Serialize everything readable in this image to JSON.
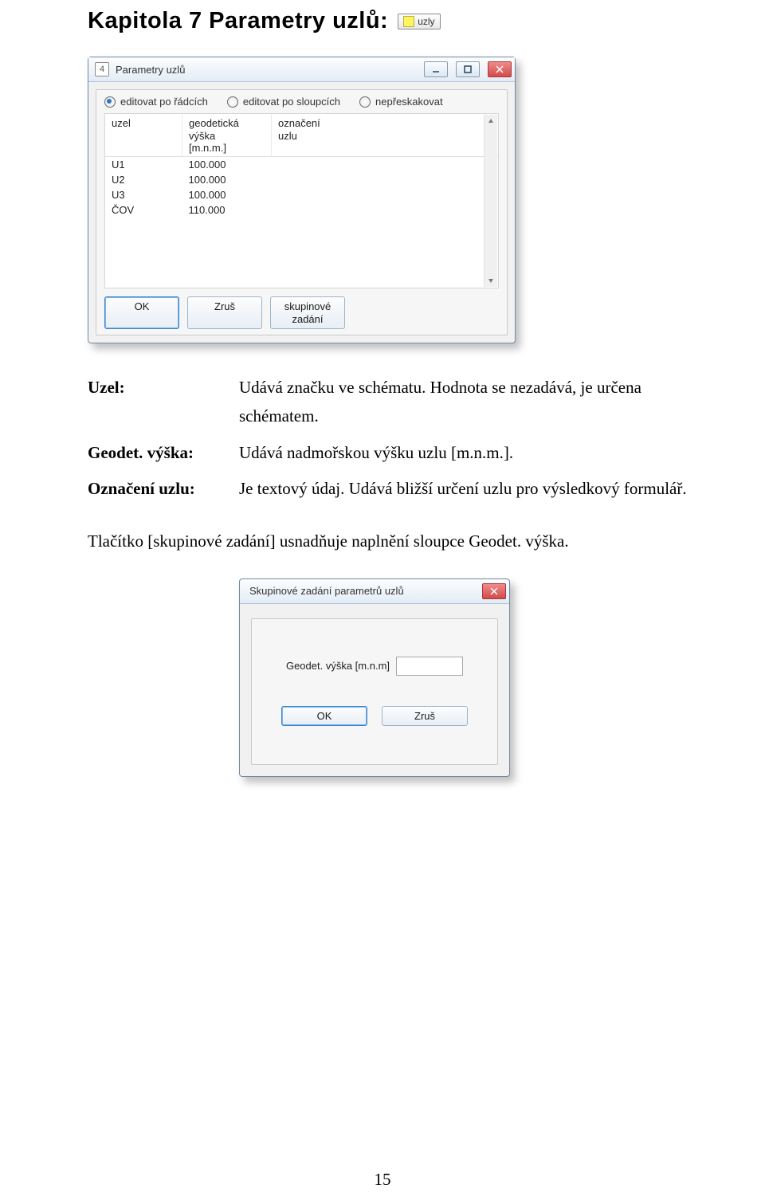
{
  "chapter": {
    "title": "Kapitola 7  Parametry uzlů:"
  },
  "toolbar_mini": {
    "label": "uzly"
  },
  "window1": {
    "icon_text": "4",
    "title": "Parametry uzlů",
    "radios": {
      "opt_rows": "editovat po řádcích",
      "opt_cols": "editovat po sloupcích",
      "opt_skip": "nepřeskakovat"
    },
    "table": {
      "headers": {
        "uzel": "uzel",
        "vyska": "geodetická\nvýška\n[m.n.m.]",
        "oznaceni": "označení\nuzlu"
      },
      "rows": [
        {
          "uzel": "U1",
          "vyska": "100.000",
          "oznaceni": ""
        },
        {
          "uzel": "U2",
          "vyska": "100.000",
          "oznaceni": ""
        },
        {
          "uzel": "U3",
          "vyska": "100.000",
          "oznaceni": ""
        },
        {
          "uzel": "ČOV",
          "vyska": "110.000",
          "oznaceni": ""
        }
      ]
    },
    "buttons": {
      "ok": "OK",
      "cancel": "Zruš",
      "group": "skupinové\nzadání"
    }
  },
  "definitions": {
    "uzel_term": "Uzel:",
    "uzel_desc": "Udává značku ve schématu. Hodnota se nezadává, je určena schématem.",
    "vyska_term": "Geodet. výška:",
    "vyska_desc": "Udává nadmořskou výšku uzlu  [m.n.m.].",
    "oznaceni_term": "Označení uzlu:",
    "oznaceni_desc": "Je textový údaj. Udává bližší určení uzlu pro výsledkový formulář."
  },
  "paragraph": "Tlačítko [skupinové zadání] usnadňuje naplnění sloupce Geodet. výška.",
  "dialog": {
    "title": "Skupinové zadání parametrů uzlů",
    "field_label": "Geodet. výška [m.n.m]",
    "buttons": {
      "ok": "OK",
      "cancel": "Zruš"
    }
  },
  "page_number": "15"
}
